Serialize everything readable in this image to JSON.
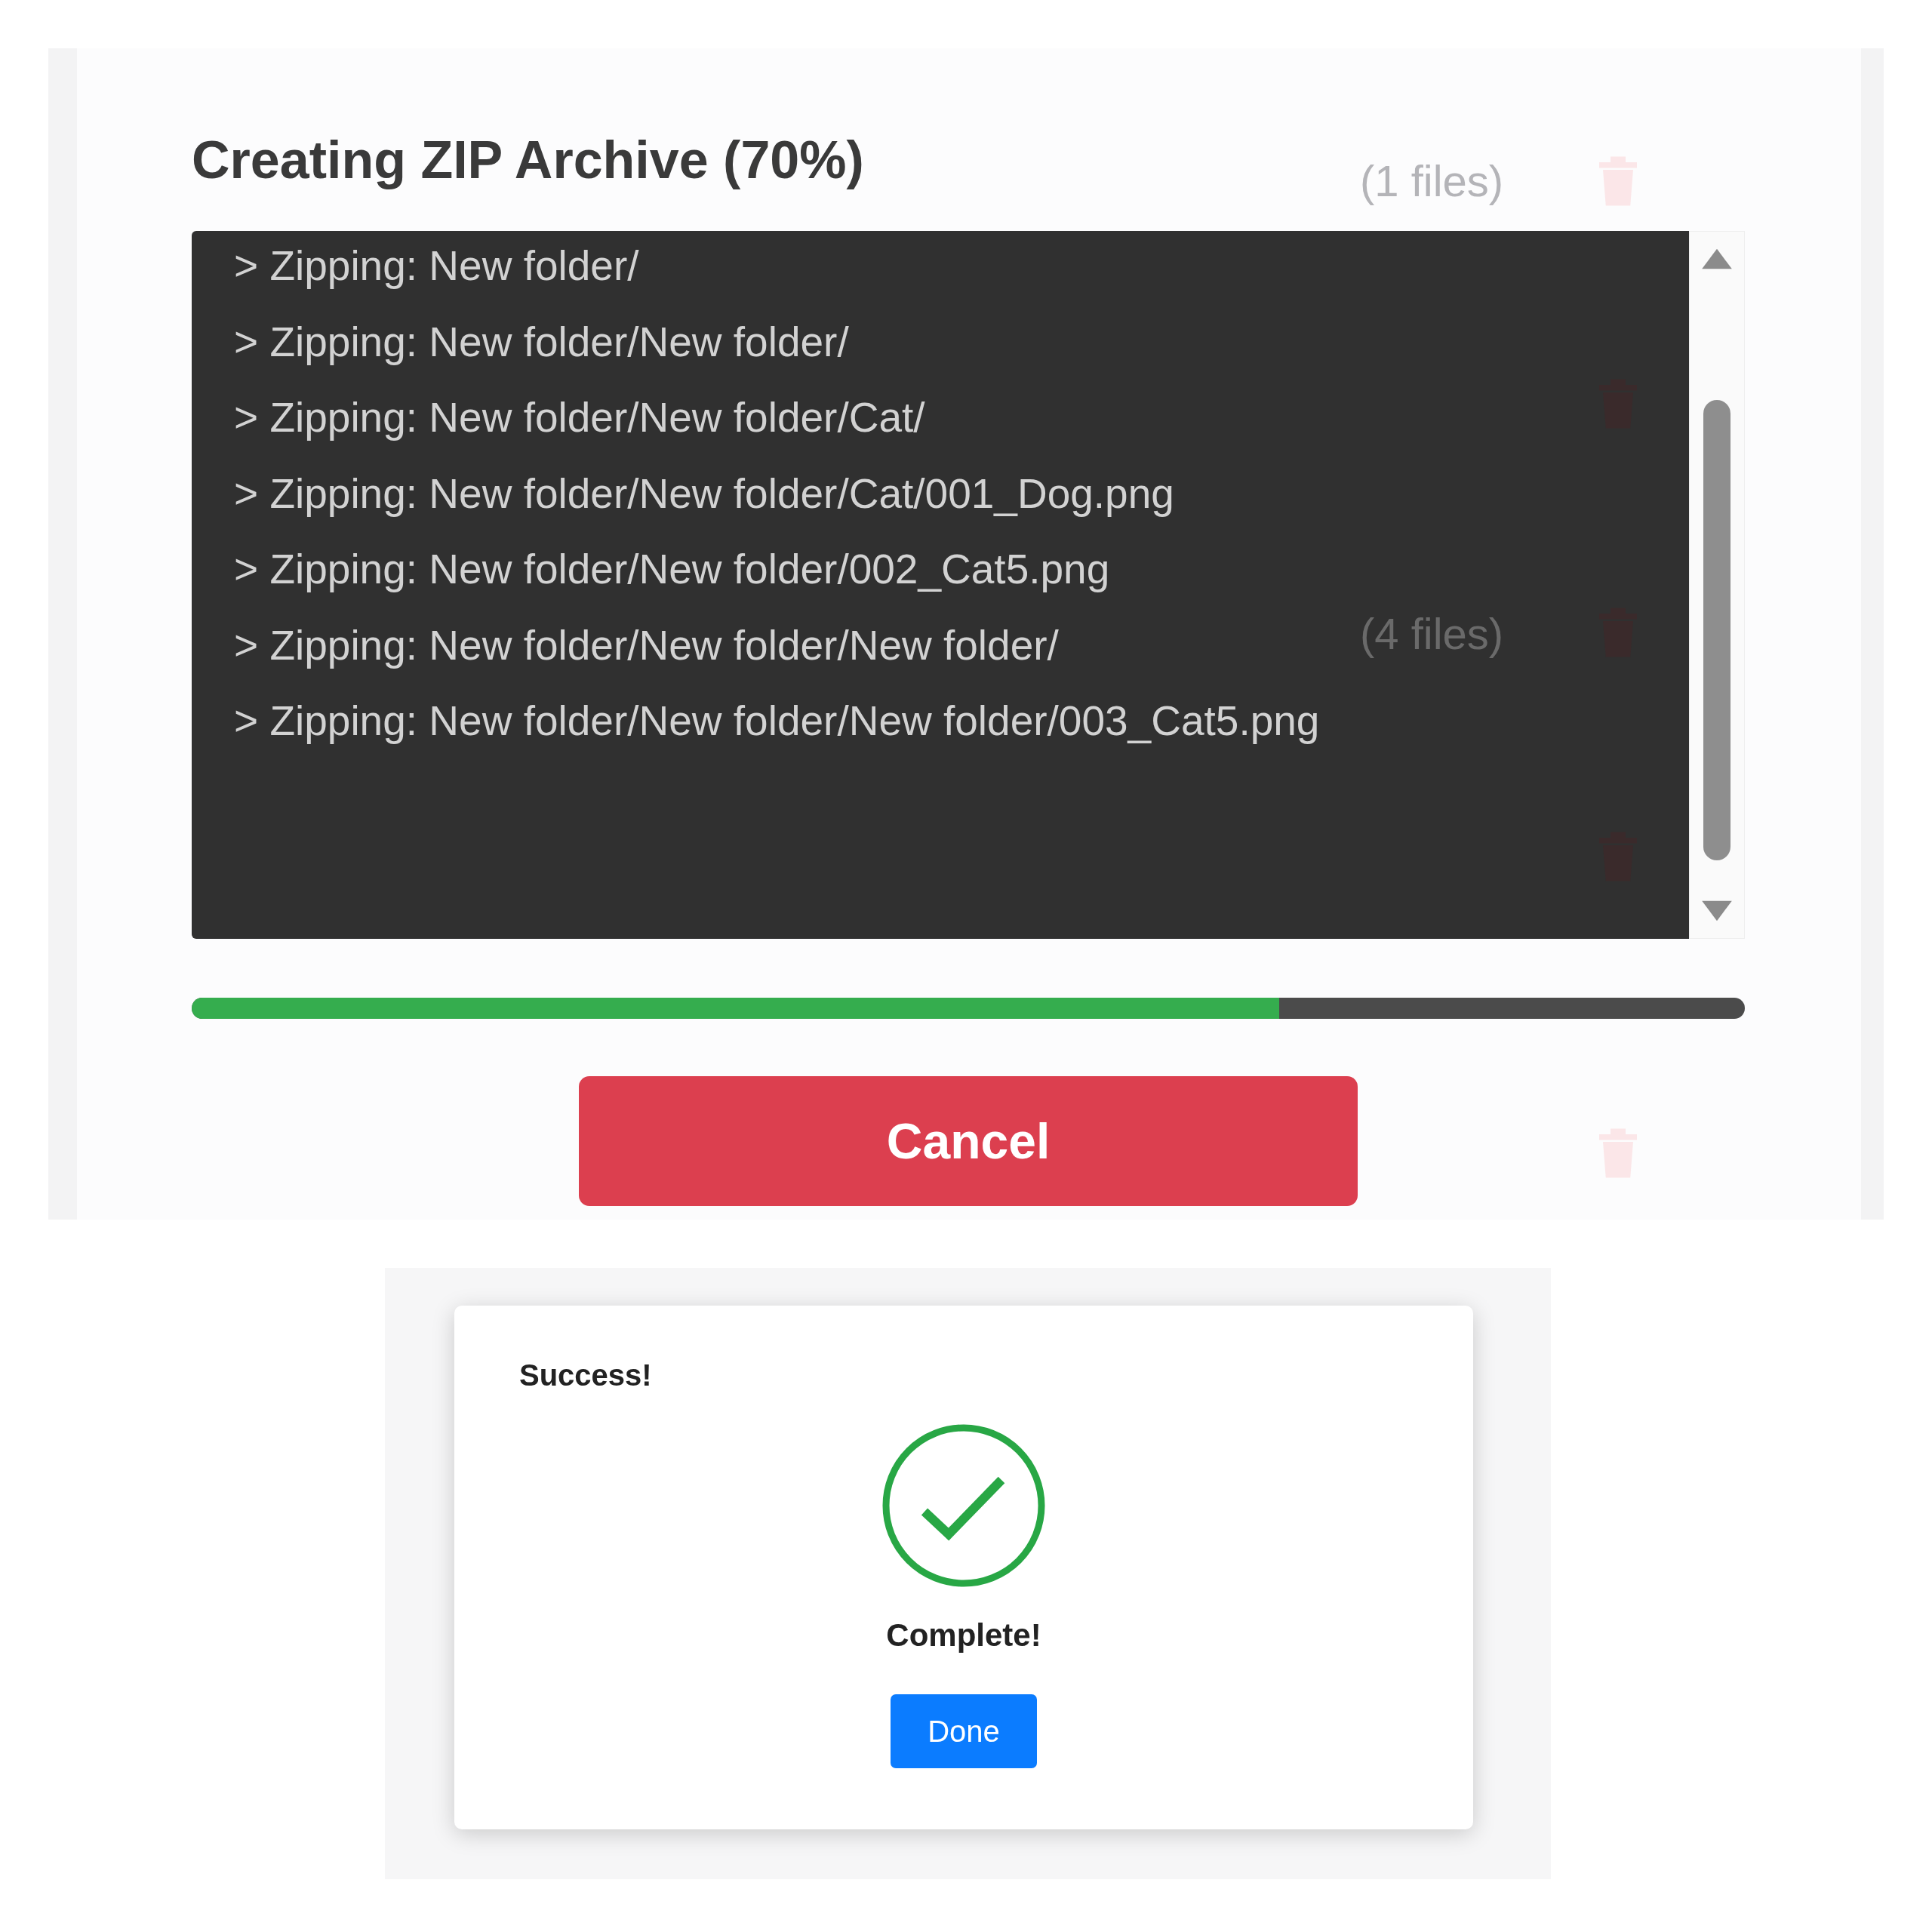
{
  "zip_dialog": {
    "title": "Creating ZIP Archive (70%)",
    "log_lines": [
      "> Zipping: New folder/",
      "> Zipping: New folder/New folder/",
      "> Zipping: New folder/New folder/Cat/",
      "> Zipping: New folder/New folder/Cat/001_Dog.png",
      "> Zipping: New folder/New folder/002_Cat5.png",
      "> Zipping: New folder/New folder/New folder/",
      "> Zipping: New folder/New folder/New folder/003_Cat5.png"
    ],
    "progress": {
      "level": 0.7
    },
    "cancel_button": "Cancel",
    "background_counts": [
      "(1 files)",
      "(4 files)"
    ]
  },
  "success_dialog": {
    "title": "Success!",
    "message": "Complete!",
    "done_button": "Done"
  }
}
